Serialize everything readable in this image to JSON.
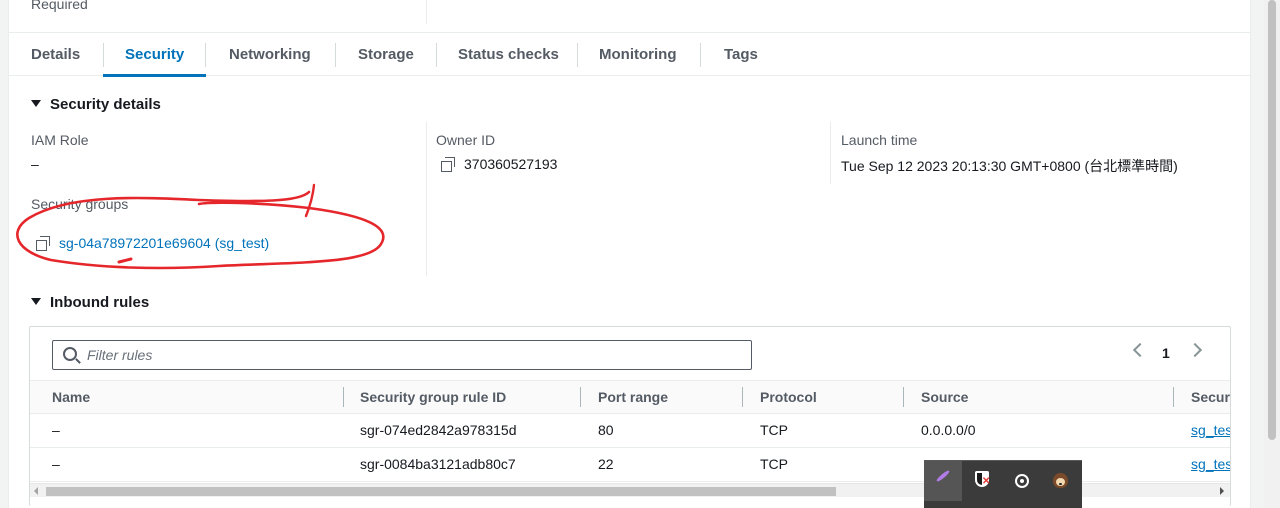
{
  "top": {
    "required_label": "Required"
  },
  "tabs": [
    {
      "label": "Details",
      "active": false
    },
    {
      "label": "Security",
      "active": true
    },
    {
      "label": "Networking",
      "active": false
    },
    {
      "label": "Storage",
      "active": false
    },
    {
      "label": "Status checks",
      "active": false
    },
    {
      "label": "Monitoring",
      "active": false
    },
    {
      "label": "Tags",
      "active": false
    }
  ],
  "security_details": {
    "title": "Security details",
    "iam_role": {
      "label": "IAM Role",
      "value": "–"
    },
    "owner_id": {
      "label": "Owner ID",
      "value": "370360527193"
    },
    "launch_time": {
      "label": "Launch time",
      "value": "Tue Sep 12 2023 20:13:30 GMT+0800 (台北標準時間)"
    },
    "security_groups": {
      "label": "Security groups",
      "value": "sg-04a78972201e69604 (sg_test)"
    }
  },
  "inbound_rules": {
    "title": "Inbound rules",
    "filter_placeholder": "Filter rules",
    "page": "1",
    "columns": [
      "Name",
      "Security group rule ID",
      "Port range",
      "Protocol",
      "Source",
      "Secur"
    ],
    "rows": [
      {
        "name": "–",
        "rule_id": "sgr-074ed2842a978315d",
        "port": "80",
        "protocol": "TCP",
        "source": "0.0.0.0/0",
        "group": "sg_tes"
      },
      {
        "name": "–",
        "rule_id": "sgr-0084ba3121adb80c7",
        "port": "22",
        "protocol": "TCP",
        "source": "",
        "group": "sg_tes"
      }
    ]
  },
  "colors": {
    "link": "#0073bb",
    "annotation": "#e5262b",
    "tray_background": "#3b3b3b"
  },
  "tray_icons": [
    "feather-icon",
    "shield-icon",
    "record-icon",
    "fox-icon"
  ]
}
